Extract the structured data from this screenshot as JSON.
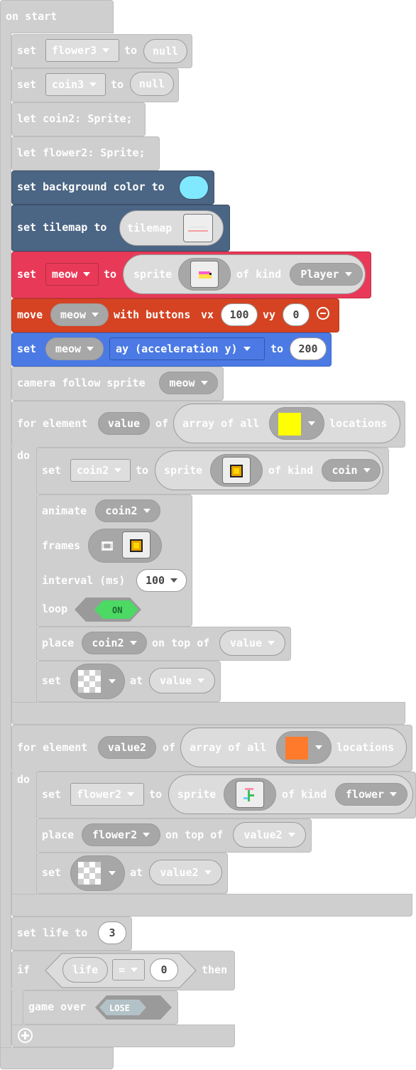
{
  "blocks": {
    "on_start": "on start",
    "set": "set",
    "to": "to",
    "let_coin2": "let coin2: Sprite;",
    "let_flower2": "let flower2: Sprite;",
    "set_bg": "set background color to",
    "set_tilemap": "set tilemap to",
    "tilemap": "tilemap",
    "sprite": "sprite",
    "of_kind": "of kind",
    "move": "move",
    "with_buttons": "with buttons",
    "vx": "vx",
    "vy": "vy",
    "camera_follow": "camera follow sprite",
    "for_element": "for element",
    "of": "of",
    "array_of_all": "array of all",
    "locations": "locations",
    "do": "do",
    "animate": "animate",
    "frames": "frames",
    "interval": "interval (ms)",
    "loop": "loop",
    "place": "place",
    "on_top_of": "on top of",
    "at": "at",
    "set_life_to": "set life to",
    "if": "if",
    "then": "then",
    "life": "life",
    "eq": "=",
    "game_over": "game over"
  },
  "vars": {
    "flower3": "flower3",
    "coin3": "coin3",
    "null": "null",
    "meow": "meow",
    "player": "Player",
    "ay": "ay (acceleration y)",
    "coin2": "coin2",
    "coin_kind": "coin",
    "value": "value",
    "value2": "value2",
    "flower2": "flower2",
    "flower_kind": "flower"
  },
  "numbers": {
    "vx": "100",
    "vy": "0",
    "ay": "200",
    "interval": "100",
    "life": "3",
    "zero": "0"
  },
  "toggles": {
    "on": "ON",
    "lose": "LOSE"
  },
  "colors": {
    "gray_block": "#cfcfcf",
    "scene_blue": "#4b6584",
    "sprite_red": "#e83a58",
    "controller_orange": "#d54322",
    "physics_blue": "#4b7ae5",
    "bg_color_swatch": "#80e8ff",
    "coin_tile": "#ffff00",
    "flower_tile": "#ff7a2b",
    "toggle_green": "#4cd964"
  },
  "icons": [
    "remove-icon",
    "film-icon",
    "add-icon",
    "dropdown-caret-icon"
  ]
}
